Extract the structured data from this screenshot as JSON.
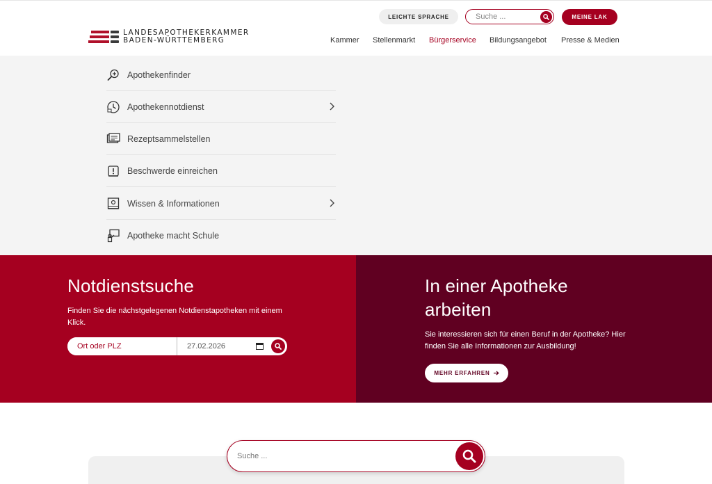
{
  "header": {
    "logo_line1": "LANDESAPOTHEKERKAMMER",
    "logo_line2": "BADEN-WÜRTTEMBERG",
    "leichte_sprache_label": "LEICHTE SPRACHE",
    "search_placeholder": "Suche ...",
    "meine_lak_label": "MEINE LAK",
    "nav": [
      {
        "label": "Kammer",
        "active": false
      },
      {
        "label": "Stellenmarkt",
        "active": false
      },
      {
        "label": "Bürgerservice",
        "active": true
      },
      {
        "label": "Bildungsangebot",
        "active": false
      },
      {
        "label": "Presse & Medien",
        "active": false
      }
    ]
  },
  "menu": {
    "items": [
      {
        "label": "Apothekenfinder",
        "icon": "magnifier-plus-icon",
        "has_submenu": false
      },
      {
        "label": "Apothekennotdienst",
        "icon": "clock-notdienst-icon",
        "has_submenu": true
      },
      {
        "label": "Rezeptsammelstellen",
        "icon": "prescription-box-icon",
        "has_submenu": false
      },
      {
        "label": "Beschwerde einreichen",
        "icon": "complaint-document-icon",
        "has_submenu": false
      },
      {
        "label": "Wissen & Informationen",
        "icon": "info-book-icon",
        "has_submenu": true
      },
      {
        "label": "Apotheke macht Schule",
        "icon": "teacher-board-icon",
        "has_submenu": false
      }
    ]
  },
  "notdienst": {
    "title": "Notdienstsuche",
    "text": "Finden Sie die nächstgelegenen Notdienstapotheken mit einem Klick.",
    "plz_placeholder": "Ort oder PLZ",
    "date_value": "27.02.2026"
  },
  "karriere": {
    "title_line1": "In einer Apotheke",
    "title_line2": "arbeiten",
    "text": "Sie interessieren sich für einen Beruf in der Apotheke? Hier finden Sie alle Informationen zur Ausbildung!",
    "button_label": "MEHR ERFAHREN"
  },
  "bottom_search": {
    "placeholder": "Suche ..."
  },
  "colors": {
    "brand_red": "#a50020",
    "dark_red": "#600021",
    "panel_grey": "#f4f4f4"
  }
}
